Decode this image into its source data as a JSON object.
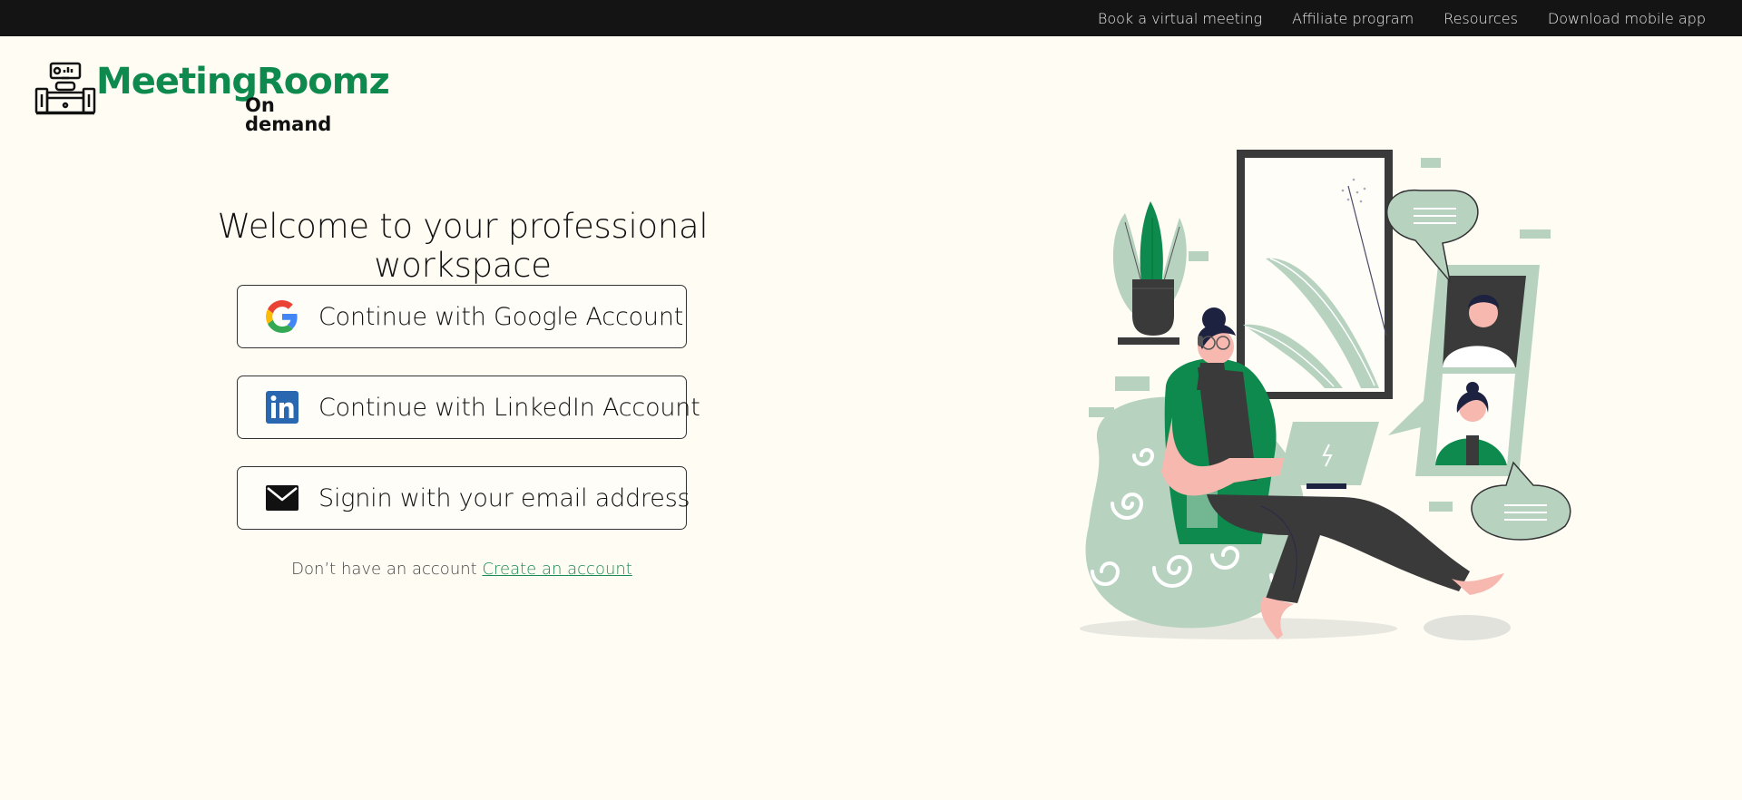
{
  "topnav": {
    "items": [
      "Book a virtual meeting",
      "Affiliate program",
      "Resources",
      "Download mobile app"
    ]
  },
  "logo": {
    "name": "MeetingRoomz",
    "tagline": "On demand",
    "brand_color": "#0e8a4e"
  },
  "welcome": {
    "heading": "Welcome to your professional workspace"
  },
  "auth": {
    "google_label": "Continue with Google Account",
    "linkedin_label": "Continue with LinkedIn Account",
    "email_label": "Signin with your email address"
  },
  "signup": {
    "prompt": "Don’t have an account",
    "link": "Create an account"
  },
  "colors": {
    "background": "#fffcf4",
    "topbar": "#141414",
    "accent_green": "#0e8a4e",
    "sage": "#b7d3c0",
    "linkedin_blue": "#2a67b1"
  },
  "icons": [
    "google-icon",
    "linkedin-icon",
    "mail-icon"
  ]
}
